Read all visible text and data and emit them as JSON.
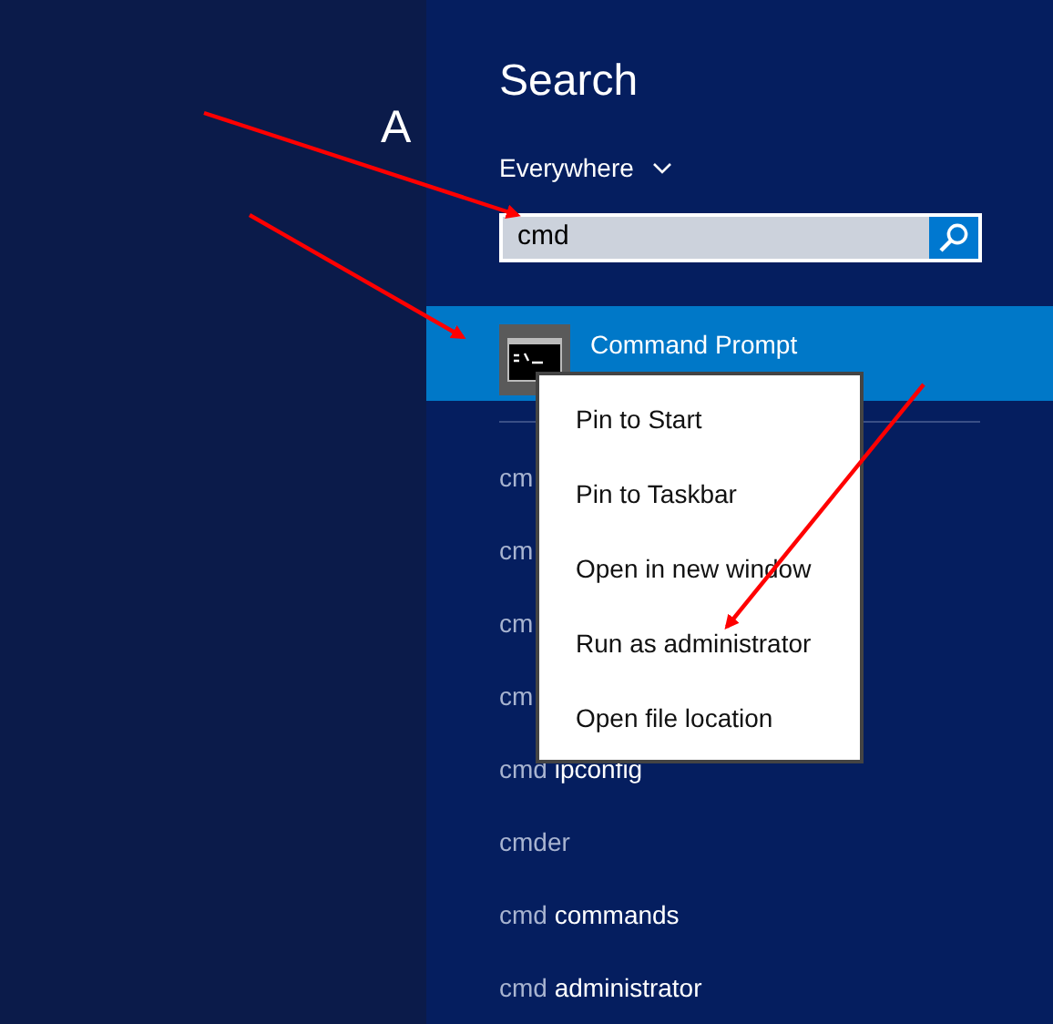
{
  "background": {
    "partial_heading": "A"
  },
  "search_pane": {
    "title": "Search",
    "scope": "Everywhere",
    "query": "cmd"
  },
  "top_result": {
    "label": "Command Prompt",
    "selected": true
  },
  "suggestions": [
    {
      "prefix": "cm"
    },
    {
      "prefix": "cm"
    },
    {
      "prefix": "cm"
    },
    {
      "prefix": "cm"
    },
    {
      "prefix": "cmd",
      "rest": " ipconfig"
    },
    {
      "prefix": "cmder"
    },
    {
      "prefix": "cmd",
      "rest": " commands"
    },
    {
      "prefix": "cmd",
      "rest": " administrator"
    }
  ],
  "context_menu": [
    "Pin to Start",
    "Pin to Taskbar",
    "Open in new window",
    "Run as administrator",
    "Open file location"
  ]
}
